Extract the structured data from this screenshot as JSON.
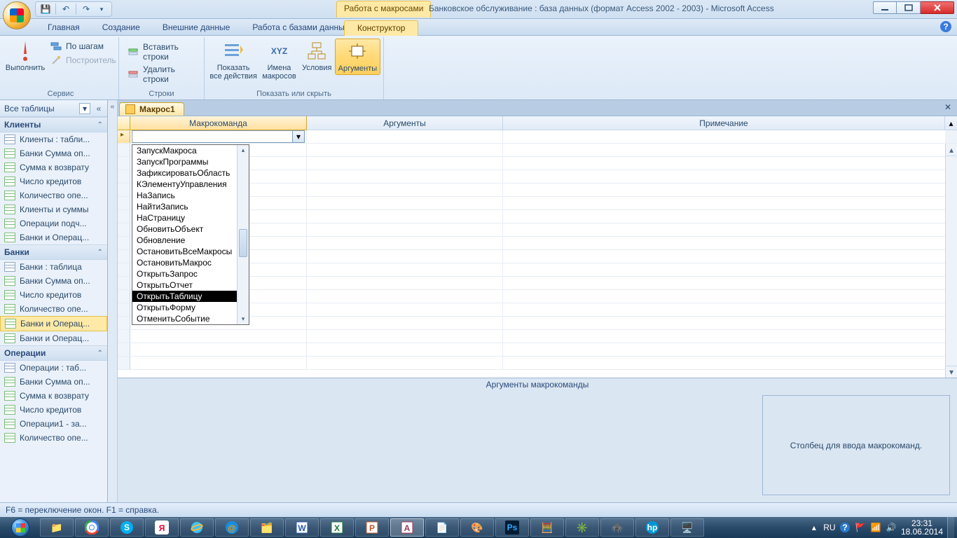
{
  "title": {
    "context_tab": "Работа с макросами",
    "document_title": "Банковское обслуживание : база данных (формат Access 2002 - 2003) - Microsoft Access"
  },
  "qat": {
    "save": "save",
    "undo": "undo",
    "redo": "redo"
  },
  "tabs": {
    "home": "Главная",
    "create": "Создание",
    "external": "Внешние данные",
    "dbtools": "Работа с базами данных",
    "designer": "Конструктор"
  },
  "ribbon": {
    "group_tools": "Сервис",
    "run": "Выполнить",
    "stepinto": "По шагам",
    "builder": "Построитель",
    "group_rows": "Строки",
    "insert_rows": "Вставить строки",
    "delete_rows": "Удалить строки",
    "group_showhide": "Показать или скрыть",
    "show_all": "Показать\nвсе действия",
    "macro_names": "Имена\nмакросов",
    "conditions": "Условия",
    "arguments": "Аргументы"
  },
  "nav": {
    "header": "Все таблицы",
    "groups": [
      {
        "name": "Клиенты",
        "items": [
          {
            "label": "Клиенты : табли...",
            "icon": "table"
          },
          {
            "label": "Банки Сумма оп...",
            "icon": "query"
          },
          {
            "label": "Сумма к возврату",
            "icon": "query"
          },
          {
            "label": "Число кредитов",
            "icon": "query"
          },
          {
            "label": "Количество опе...",
            "icon": "query"
          },
          {
            "label": "Клиенты и суммы",
            "icon": "query"
          },
          {
            "label": "Операции подч...",
            "icon": "query"
          },
          {
            "label": "Банки и Операц...",
            "icon": "query"
          }
        ]
      },
      {
        "name": "Банки",
        "items": [
          {
            "label": "Банки : таблица",
            "icon": "table"
          },
          {
            "label": "Банки Сумма оп...",
            "icon": "query"
          },
          {
            "label": "Число кредитов",
            "icon": "query"
          },
          {
            "label": "Количество опе...",
            "icon": "query"
          },
          {
            "label": "Банки и Операц...",
            "icon": "query",
            "sel": true
          },
          {
            "label": "Банки и Операц...",
            "icon": "query"
          }
        ]
      },
      {
        "name": "Операции",
        "items": [
          {
            "label": "Операции : таб...",
            "icon": "table"
          },
          {
            "label": "Банки Сумма оп...",
            "icon": "query"
          },
          {
            "label": "Сумма к возврату",
            "icon": "query"
          },
          {
            "label": "Число кредитов",
            "icon": "query"
          },
          {
            "label": "Операции1 - за...",
            "icon": "query"
          },
          {
            "label": "Количество опе...",
            "icon": "query"
          }
        ]
      }
    ]
  },
  "doc": {
    "tab_name": "Макрос1",
    "col_cmd": "Макрокоманда",
    "col_args": "Аргументы",
    "col_note": "Примечание",
    "dd_options": [
      "ЗапускМакроса",
      "ЗапускПрограммы",
      "ЗафиксироватьОбласть",
      "КЭлементуУправления",
      "НаЗапись",
      "НайтиЗапись",
      "НаСтраницу",
      "ОбновитьОбъект",
      "Обновление",
      "ОстановитьВсеМакросы",
      "ОстановитьМакрос",
      "ОткрытьЗапрос",
      "ОткрытьОтчет",
      "ОткрытьТаблицу",
      "ОткрытьФорму",
      "ОтменитьСобытие"
    ],
    "dd_selected_index": 13,
    "args_pane_title": "Аргументы макрокоманды",
    "hint": "Столбец для ввода макрокоманд."
  },
  "statusbar": "F6 = переключение окон.  F1 = справка.",
  "taskbar": {
    "lang": "RU",
    "time": "23:31",
    "date": "18.06.2014"
  }
}
